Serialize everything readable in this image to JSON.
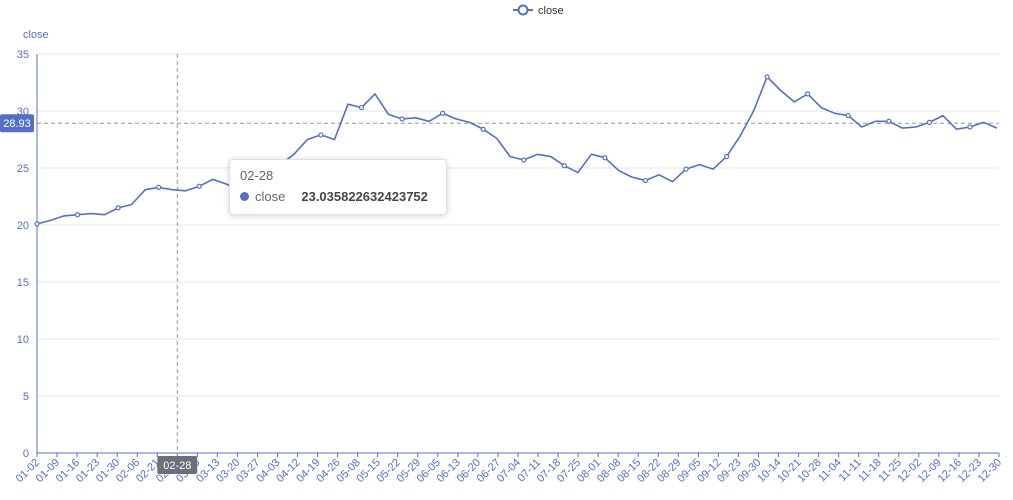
{
  "chart_data": {
    "type": "line",
    "title": "",
    "ylabel": "close",
    "xlabel": "",
    "ylim": [
      0,
      35
    ],
    "yticks": [
      0,
      5,
      10,
      15,
      20,
      25,
      30,
      35
    ],
    "grid": true,
    "legend_position": "top-center",
    "series_color": "#5470c6",
    "reference_line_value": "28.93",
    "pointer_label": "02-28",
    "xticks": [
      "01-02",
      "01-09",
      "01-16",
      "01-23",
      "01-30",
      "02-06",
      "02-21",
      "02-28",
      "03-06",
      "03-13",
      "03-20",
      "03-27",
      "04-03",
      "04-12",
      "04-19",
      "04-26",
      "05-08",
      "05-15",
      "05-22",
      "05-29",
      "06-05",
      "06-13",
      "06-20",
      "06-27",
      "07-04",
      "07-11",
      "07-18",
      "07-25",
      "08-01",
      "08-08",
      "08-15",
      "08-22",
      "08-29",
      "09-05",
      "09-12",
      "09-23",
      "09-30",
      "10-14",
      "10-21",
      "10-28",
      "11-04",
      "11-11",
      "11-18",
      "11-25",
      "12-02",
      "12-09",
      "12-16",
      "12-23",
      "12-30"
    ],
    "series": [
      {
        "name": "close",
        "values": [
          20.1,
          20.4,
          20.8,
          20.9,
          21.0,
          20.9,
          21.5,
          21.8,
          23.1,
          23.3,
          23.1,
          23.0,
          23.4,
          24.0,
          23.6,
          23.0,
          23.4,
          24.5,
          25.3,
          26.2,
          27.5,
          27.9,
          27.5,
          30.6,
          30.3,
          31.5,
          29.7,
          29.3,
          29.4,
          29.1,
          29.8,
          29.3,
          29.0,
          28.4,
          27.6,
          26.0,
          25.7,
          26.2,
          26.0,
          25.2,
          24.6,
          26.2,
          25.9,
          24.8,
          24.2,
          23.9,
          24.4,
          23.8,
          24.9,
          25.3,
          24.9,
          26.0,
          27.8,
          30.0,
          33.0,
          31.8,
          30.8,
          31.5,
          30.3,
          29.8,
          29.6,
          28.6,
          29.1,
          29.1,
          28.5,
          28.6,
          29.0,
          29.6,
          28.4,
          28.6,
          29.0,
          28.5
        ]
      }
    ]
  },
  "legend": {
    "label": "close"
  },
  "tooltip": {
    "title": "02-28",
    "series_name": "close",
    "value": "23.035822632423752"
  }
}
